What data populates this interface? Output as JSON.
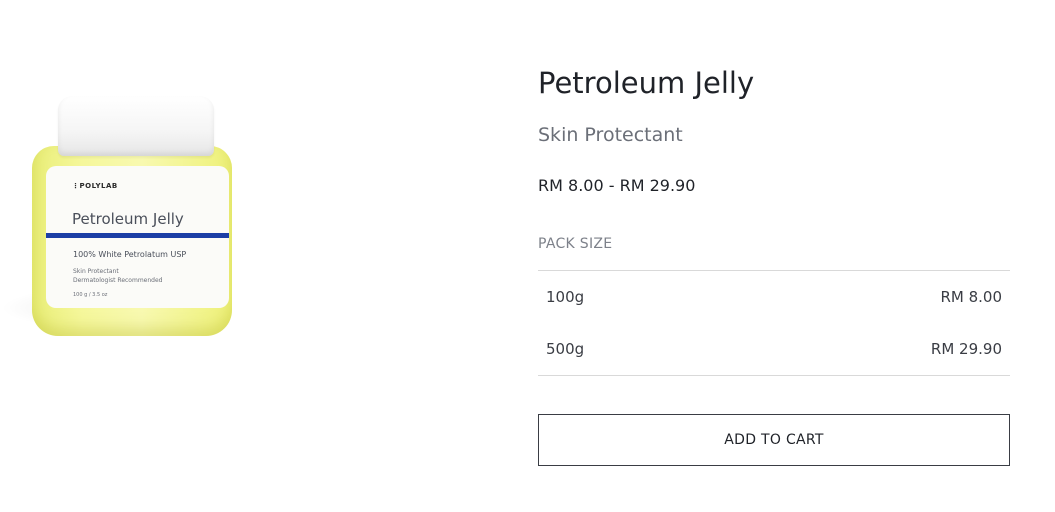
{
  "product": {
    "title": "Petroleum Jelly",
    "subtitle": "Skin Protectant",
    "price_range": "RM 8.00 - RM 29.90",
    "image": {
      "brand": "POLYLAB",
      "label_title": "Petroleum Jelly",
      "label_subtitle": "100% White Petrolatum USP",
      "label_lines": [
        "Skin Protectant",
        "Dermatologist Recommended",
        "100 g / 3.5 oz"
      ],
      "colors": {
        "jelly": "#f5f79b",
        "stripe": "#1c3fa6",
        "lid": "#ffffff"
      }
    }
  },
  "pack_size": {
    "label": "PACK SIZE",
    "options": [
      {
        "size": "100g",
        "price": "RM 8.00"
      },
      {
        "size": "500g",
        "price": "RM 29.90"
      }
    ]
  },
  "actions": {
    "add_to_cart": "ADD TO CART"
  }
}
